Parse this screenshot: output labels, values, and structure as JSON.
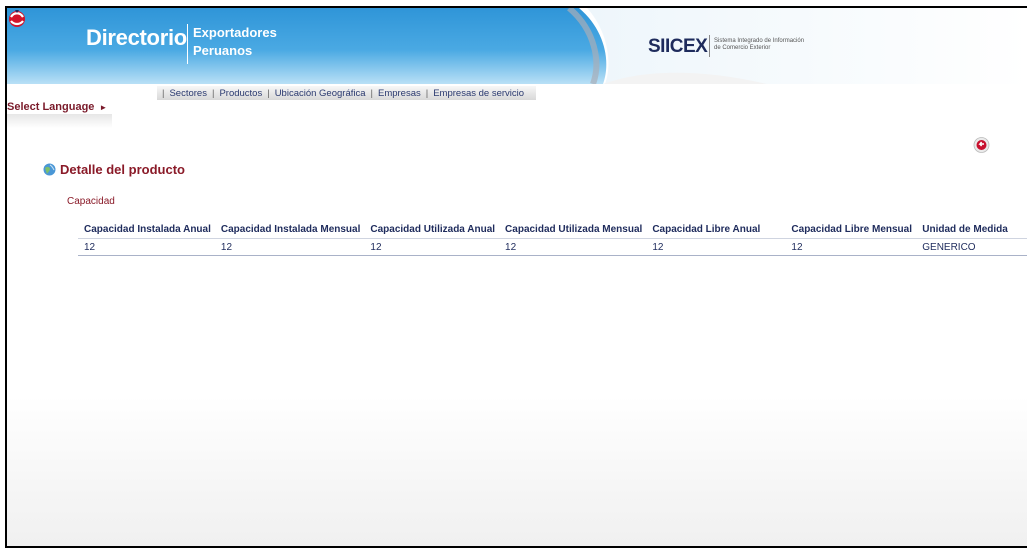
{
  "header": {
    "title": "Directorio",
    "subtitle_line1": "Exportadores",
    "subtitle_line2": "Peruanos",
    "partner_logo_icon": "siicex-logo-icon",
    "partner_name": "SIICEX",
    "partner_desc_line1": "Sistema Integrado de Información",
    "partner_desc_line2": "de Comercio Exterior",
    "colors": {
      "banner": "#2f95d8",
      "banner_light": "#9fd3f2",
      "accent": "#8a1a28",
      "text": "#1e2b5c"
    }
  },
  "nav": {
    "items": [
      {
        "label": "Sectores"
      },
      {
        "label": "Productos"
      },
      {
        "label": "Ubicación Geográfica"
      },
      {
        "label": "Empresas"
      },
      {
        "label": "Empresas de servicio"
      }
    ]
  },
  "language": {
    "label": "Select Language",
    "arrow_icon": "arrow-right-icon"
  },
  "back_icon": "back-arrow-icon",
  "section": {
    "icon": "globe-icon",
    "title": "Detalle del producto",
    "subtitle": "Capacidad"
  },
  "table": {
    "headers": [
      "Capacidad Instalada Anual",
      "Capacidad Instalada Mensual",
      "Capacidad Utilizada Anual",
      "Capacidad Utilizada Mensual",
      "Capacidad Libre Anual",
      "Capacidad Libre Mensual",
      "Unidad de Medida"
    ],
    "rows": [
      [
        "12",
        "12",
        "12",
        "12",
        "12",
        "12",
        "GENERICO"
      ]
    ]
  }
}
